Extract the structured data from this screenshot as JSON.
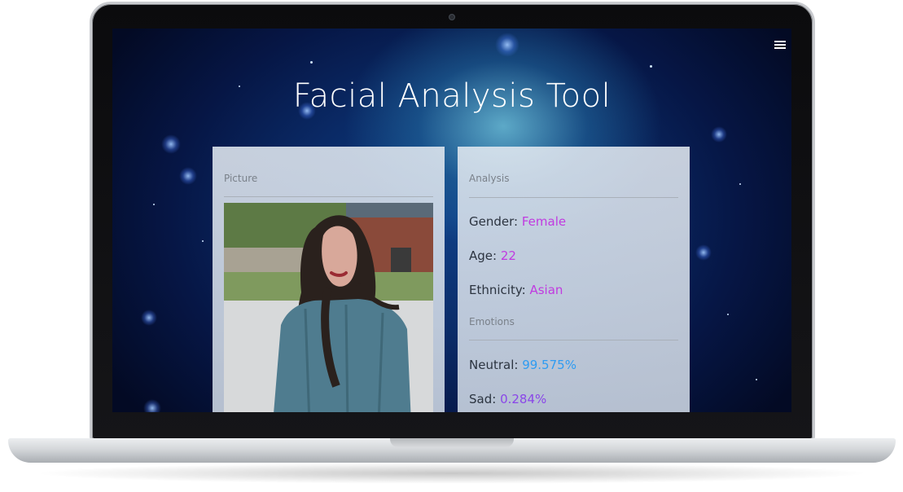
{
  "app": {
    "title": "Facial Analysis Tool"
  },
  "picture_panel": {
    "heading": "Picture"
  },
  "analysis_panel": {
    "heading": "Analysis",
    "gender": {
      "label": "Gender:",
      "value": "Female"
    },
    "age": {
      "label": "Age:",
      "value": "22"
    },
    "ethnicity": {
      "label": "Ethnicity:",
      "value": "Asian"
    },
    "emotions_heading": "Emotions",
    "emotions": [
      {
        "label": "Neutral:",
        "value": "99.575%"
      },
      {
        "label": "Sad:",
        "value": "0.284%"
      }
    ]
  },
  "icons": {
    "menu": "hamburger-menu-icon"
  },
  "colors": {
    "gender_value": "#c03be0",
    "neutral_value": "#2e9cf2",
    "sad_value": "#8a46e8",
    "title": "#ffffff"
  }
}
